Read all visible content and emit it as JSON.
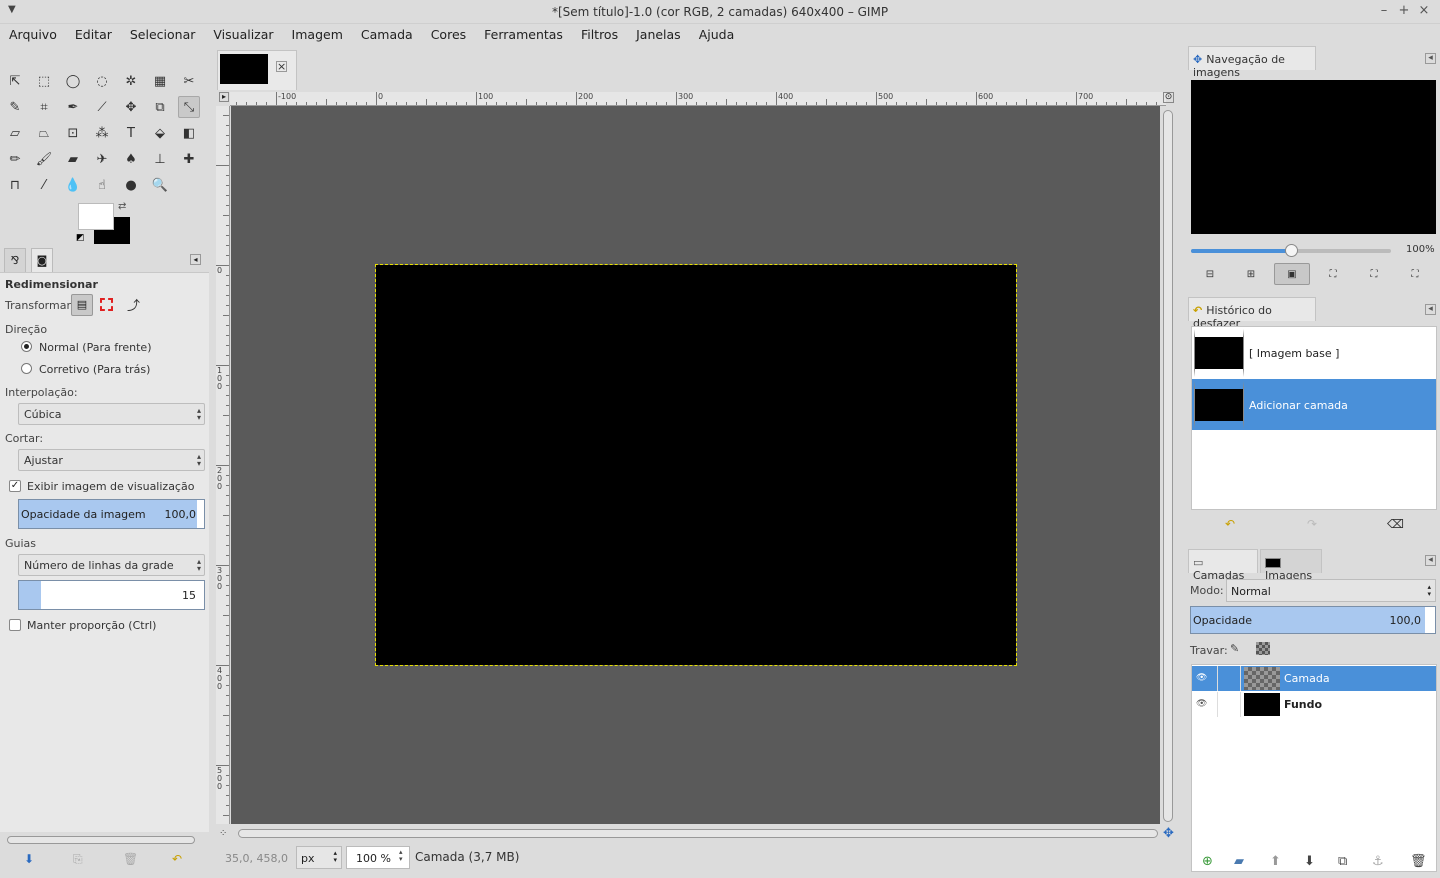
{
  "window": {
    "title": "*[Sem título]-1.0 (cor RGB, 2 camadas) 640x400 – GIMP"
  },
  "menu": [
    "Arquivo",
    "Editar",
    "Selecionar",
    "Visualizar",
    "Imagem",
    "Camada",
    "Cores",
    "Ferramentas",
    "Filtros",
    "Janelas",
    "Ajuda"
  ],
  "tool_options": {
    "title": "Redimensionar",
    "transform_label": "Transformar:",
    "direction_label": "Direção",
    "direction_normal": "Normal (Para frente)",
    "direction_corrective": "Corretivo (Para trás)",
    "interpolation_label": "Interpolação:",
    "interpolation_value": "Cúbica",
    "clip_label": "Cortar:",
    "clip_value": "Ajustar",
    "show_preview_label": "Exibir imagem de visualização",
    "show_preview_checked": true,
    "image_opacity_label": "Opacidade da imagem",
    "image_opacity_value": "100,0",
    "guides_label": "Guias",
    "guides_value": "Número de linhas da grade",
    "grid_lines_value": "15",
    "keep_aspect_label": "Manter proporção (Ctrl)"
  },
  "ruler": {
    "h_labels": [
      "-100",
      "0",
      "100",
      "200",
      "300",
      "400",
      "500",
      "600",
      "700"
    ],
    "v_labels": [
      "0",
      "100",
      "200",
      "300",
      "400",
      "500"
    ]
  },
  "status": {
    "coords": "35,0, 458,0",
    "unit": "px",
    "zoom": "100 %",
    "layer_info": "Camada (3,7 MB)"
  },
  "navigation": {
    "title": "Navegação de imagens",
    "zoom_pct": "100%",
    "zoom_fraction": 0.5
  },
  "undo_history": {
    "title": "Histórico do desfazer",
    "items": [
      "[ Imagem base ]",
      "Adicionar camada"
    ]
  },
  "layers_panel": {
    "tab_layers": "Camadas",
    "tab_images": "Imagens",
    "mode_label": "Modo:",
    "mode_value": "Normal",
    "opacity_label": "Opacidade",
    "opacity_value": "100,0",
    "lock_label": "Travar:",
    "layers": [
      "Camada",
      "Fundo"
    ]
  },
  "colors": {
    "accent": "#4a90d9",
    "canvas_bg": "#5a5a5a"
  }
}
